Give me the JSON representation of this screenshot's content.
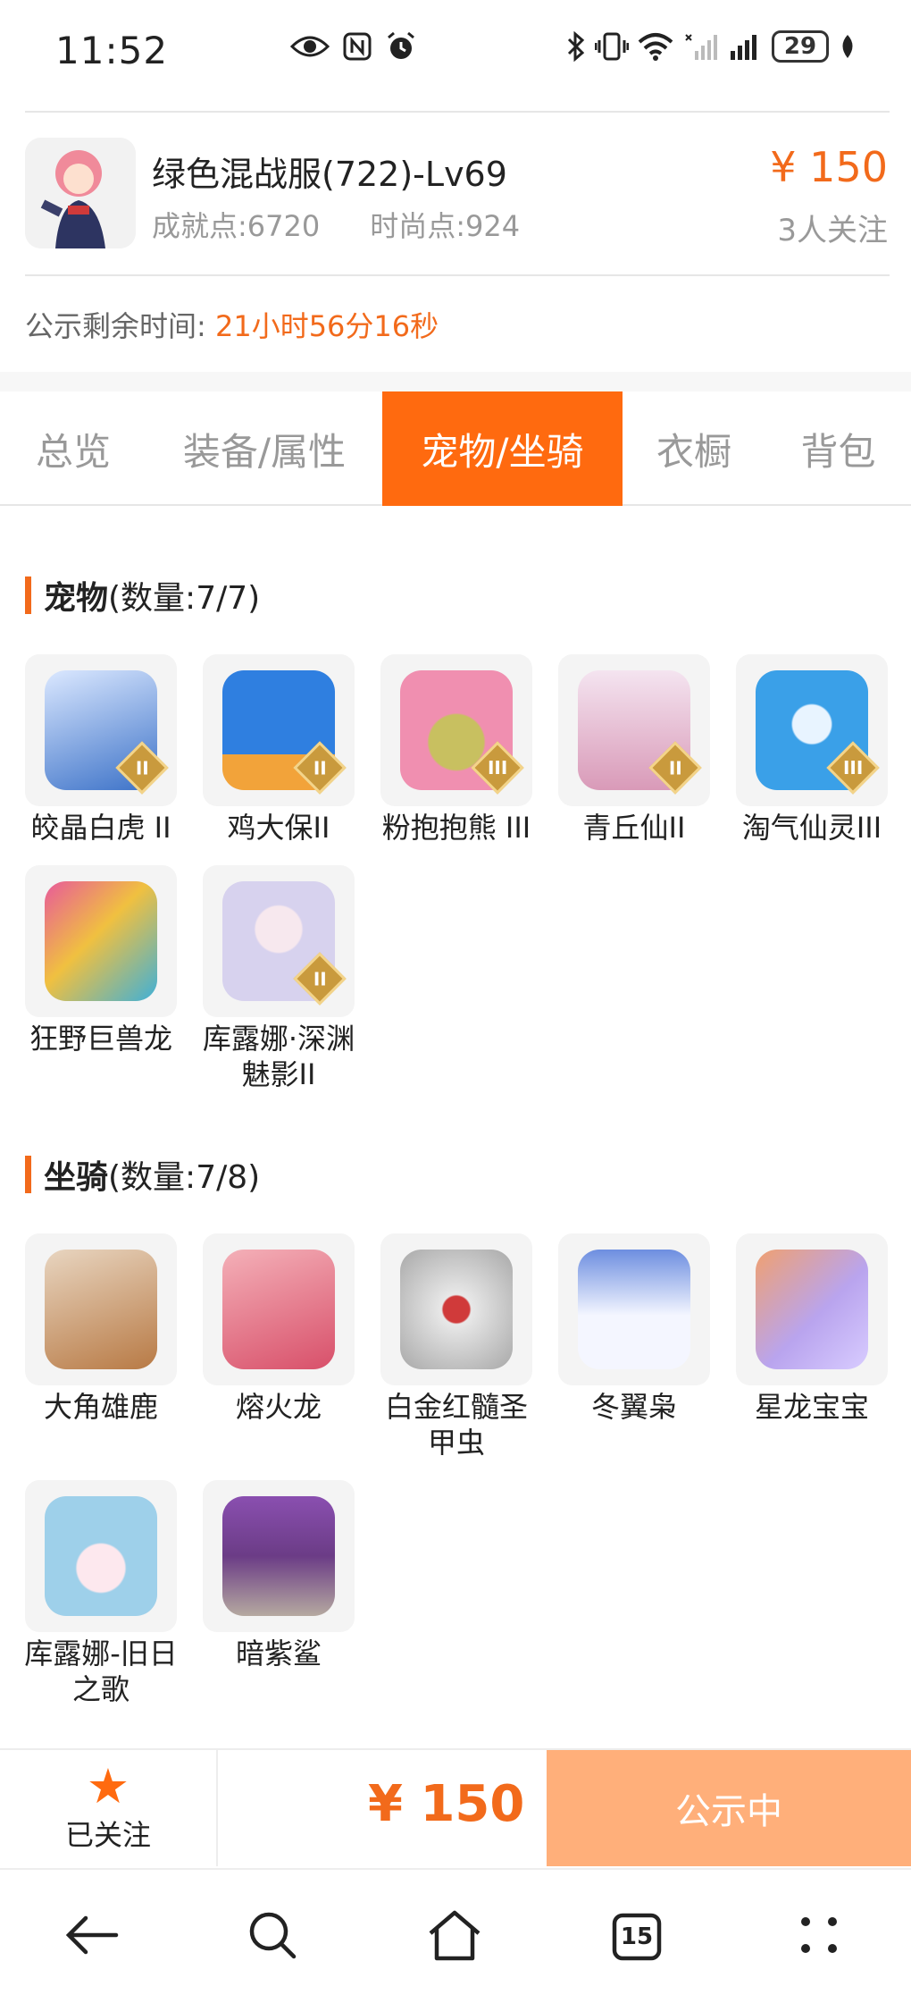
{
  "status_bar": {
    "time": "11:52",
    "battery": "29",
    "icons_mid": [
      "eye-icon",
      "nfc-icon",
      "alarm-icon"
    ],
    "icons_right": [
      "bluetooth-icon",
      "vibrate-icon",
      "wifi-icon",
      "signal-icon",
      "signal-icon"
    ]
  },
  "item": {
    "title": "绿色混战服(722)-Lv69",
    "achievement": "成就点:6720",
    "fashion": "时尚点:924",
    "price": "¥ 150",
    "follows": "3人关注",
    "countdown_label": "公示剩余时间:",
    "countdown_value": "21小时56分16秒"
  },
  "tabs": [
    {
      "label": "总览",
      "active": false
    },
    {
      "label": "装备/属性",
      "active": false
    },
    {
      "label": "宠物/坐骑",
      "active": true
    },
    {
      "label": "衣橱",
      "active": false
    },
    {
      "label": "背包",
      "active": false
    }
  ],
  "pets": {
    "title": "宠物",
    "count": "(数量:7/7)",
    "items": [
      {
        "name": "皎晶白虎 II",
        "badge": "II",
        "color": "#3c72c8"
      },
      {
        "name": "鸡大保II",
        "badge": "II",
        "color": "#2f7fe0"
      },
      {
        "name": "粉抱抱熊 III",
        "badge": "III",
        "color": "#f08fb0"
      },
      {
        "name": "青丘仙II",
        "badge": "II",
        "color": "#e9c2d8"
      },
      {
        "name": "淘气仙灵III",
        "badge": "III",
        "color": "#3aa0e8"
      },
      {
        "name": "狂野巨兽龙",
        "badge": "",
        "color": "#d9a23a"
      },
      {
        "name": "库露娜·深渊魅影II",
        "badge": "II",
        "color": "#d7d2ee"
      }
    ]
  },
  "mounts": {
    "title": "坐骑",
    "count": "(数量:7/8)",
    "items": [
      {
        "name": "大角雄鹿",
        "color": "#b87a45"
      },
      {
        "name": "熔火龙",
        "color": "#d8506a"
      },
      {
        "name": "白金红髓圣甲虫",
        "color": "#c9c9c9"
      },
      {
        "name": "冬翼枭",
        "color": "#6d8ee0"
      },
      {
        "name": "星龙宝宝",
        "color": "#b9a4ee"
      },
      {
        "name": "库露娜-旧日之歌",
        "color": "#9ed0ea"
      },
      {
        "name": "暗紫鲨",
        "color": "#6b3c86"
      }
    ]
  },
  "bottom": {
    "follow_label": "已关注",
    "price": "¥ 150",
    "status_button": "公示中"
  },
  "nav": {
    "tab_count": "15"
  }
}
